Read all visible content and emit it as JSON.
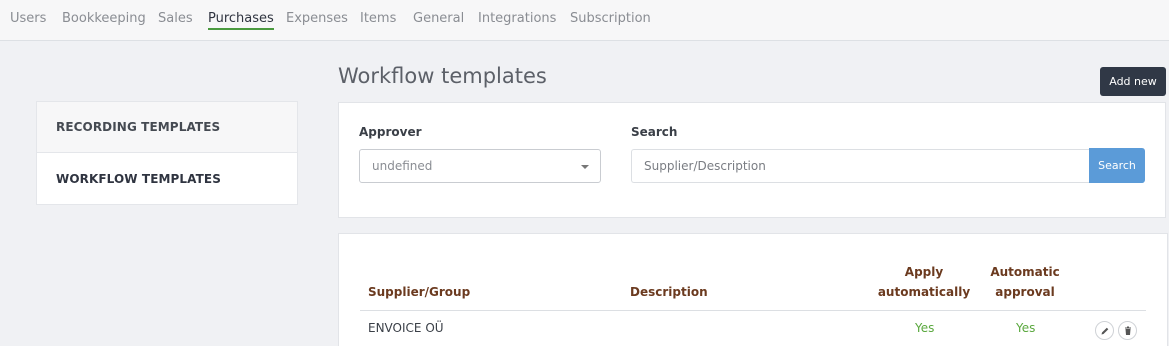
{
  "nav": {
    "tabs": [
      {
        "label": "Users"
      },
      {
        "label": "Bookkeeping"
      },
      {
        "label": "Sales"
      },
      {
        "label": "Purchases",
        "active": true
      },
      {
        "label": "Expenses"
      },
      {
        "label": "Items"
      },
      {
        "label": "General"
      },
      {
        "label": "Integrations"
      },
      {
        "label": "Subscription"
      }
    ]
  },
  "sidebar": {
    "items": [
      {
        "label": "RECORDING TEMPLATES"
      },
      {
        "label": "WORKFLOW TEMPLATES",
        "active": true
      }
    ]
  },
  "main": {
    "title": "Workflow templates",
    "add_button": "Add new"
  },
  "filters": {
    "approver_label": "Approver",
    "approver_value": "undefined",
    "search_label": "Search",
    "search_placeholder": "Supplier/Description",
    "search_button": "Search"
  },
  "table": {
    "columns": {
      "supplier": "Supplier/Group",
      "description": "Description",
      "apply_line1": "Apply",
      "apply_line2": "automatically",
      "auto_line1": "Automatic",
      "auto_line2": "approval"
    },
    "rows": [
      {
        "supplier": "ENVOICE OÜ",
        "description": "",
        "apply_automatically": "Yes",
        "automatic_approval": "Yes"
      }
    ]
  },
  "colors": {
    "active_underline": "#4a9a3f",
    "header_text": "#6b3a1f",
    "yes_text": "#5aa83e",
    "primary_button": "#303846",
    "search_button": "#5b9bd8"
  },
  "icons": {
    "edit": "pencil-icon",
    "delete": "trash-icon",
    "dropdown": "chevron-down-icon"
  }
}
